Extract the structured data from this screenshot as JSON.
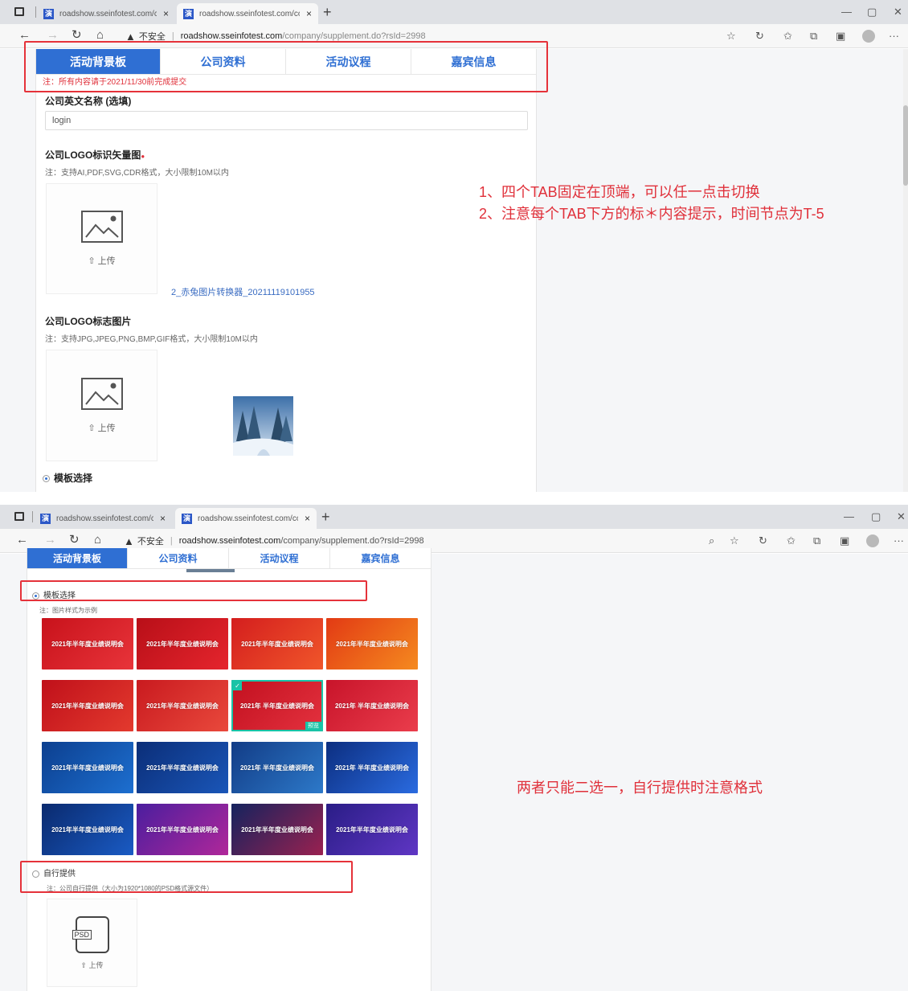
{
  "browser": {
    "tabs": [
      {
        "favicon": "演",
        "title": "roadshow.sseinfotest.com/comp"
      },
      {
        "favicon": "演",
        "title": "roadshow.sseinfotest.com/comp"
      }
    ],
    "new_tab": "+",
    "window_controls": [
      "—",
      "▢",
      "✕"
    ],
    "close_tab": "×",
    "security_label": "不安全",
    "url_host": "roadshow.sseinfotest.com",
    "url_path": "/company/supplement.do?rsId=2998",
    "icons": [
      "back-icon",
      "forward-icon",
      "refresh-icon",
      "home-icon",
      "warning-icon",
      "zoom-icon",
      "add-favorite-icon",
      "extensions-icon",
      "favorites-icon",
      "collections-icon",
      "share-icon",
      "profile-icon",
      "more-icon"
    ]
  },
  "page_tabs": [
    "活动背景板",
    "公司资料",
    "活动议程",
    "嘉宾信息"
  ],
  "shot1": {
    "deadline_note": "注：所有内容请于2021/11/30前完成提交",
    "english_name_label": "公司英文名称 (选填)",
    "english_name_value": "login",
    "logo_vector_label": "公司LOGO标识矢量图",
    "required_mark": "●",
    "logo_vector_hint": "注：支持AI,PDF,SVG,CDR格式，大小限制10M以内",
    "upload_label": "上传",
    "uploaded_file": "2_赤兔图片转换器_20211119101955",
    "logo_image_label": "公司LOGO标志图片",
    "logo_image_hint": "注：支持JPG,JPEG,PNG,BMP,GIF格式，大小限制10M以内",
    "template_choice_label": "模板选择",
    "annotation_lines": [
      "1、四个TAB固定在顶端，可以任一点击切换",
      "2、注意每个TAB下方的标＊内容提示，时间节点为T-5"
    ]
  },
  "shot2": {
    "template_choice_label": "模板选择",
    "template_hint": "注：图片样式为示例",
    "self_provide_label": "自行提供",
    "self_provide_hint": "注：公司自行提供（大小为1920*1080的PSD格式源文件）",
    "psd_label": "PSD",
    "upload_label": "上传",
    "annotation": "两者只能二选一，自行提供时注意格式",
    "selected_check": "✓",
    "preview_badge": "预览",
    "templates": [
      {
        "text": "2021年半年度业绩说明会",
        "c1": "#c8121b",
        "c2": "#e8343a"
      },
      {
        "text": "2021年半年度业绩说明会",
        "c1": "#b80f18",
        "c2": "#e5252d"
      },
      {
        "text": "2021年半年度业绩说明会",
        "c1": "#d41e1e",
        "c2": "#f0562a"
      },
      {
        "text": "2021年半年度业绩说明会",
        "c1": "#e23a14",
        "c2": "#f58a1f"
      },
      {
        "text": "2021年半年度业绩说明会",
        "c1": "#c0101a",
        "c2": "#e33a2e"
      },
      {
        "text": "2021年半年度业绩说明会",
        "c1": "#c91a1f",
        "c2": "#e9493c"
      },
      {
        "text": "2021年 半年度业绩说明会",
        "c1": "#c2101f",
        "c2": "#e4323f"
      },
      {
        "text": "2021年 半年度业绩说明会",
        "c1": "#c8142a",
        "c2": "#ea3d4c"
      },
      {
        "text": "2021年半年度业绩说明会",
        "c1": "#0c3f8f",
        "c2": "#1d6fd0"
      },
      {
        "text": "2021年半年度业绩说明会",
        "c1": "#0b2e78",
        "c2": "#1a56b8"
      },
      {
        "text": "2021年 半年度业绩说明会",
        "c1": "#123c86",
        "c2": "#2d79c9"
      },
      {
        "text": "2021年 半年度业绩说明会",
        "c1": "#0c2e80",
        "c2": "#2a6be0"
      },
      {
        "text": "2021年半年度业绩说明会",
        "c1": "#0a2a6e",
        "c2": "#1a5bc4"
      },
      {
        "text": "2021年半年度业绩说明会",
        "c1": "#4b1e9e",
        "c2": "#b0279a"
      },
      {
        "text": "2021年半年度业绩说明会",
        "c1": "#15235e",
        "c2": "#9a2150"
      },
      {
        "text": "2021年半年度业绩说明会",
        "c1": "#2a1d86",
        "c2": "#5f36c4"
      }
    ]
  },
  "colors": {
    "primary": "#2f6fd3",
    "annotation_red": "#e0303a",
    "selected_teal": "#19c3a7"
  }
}
